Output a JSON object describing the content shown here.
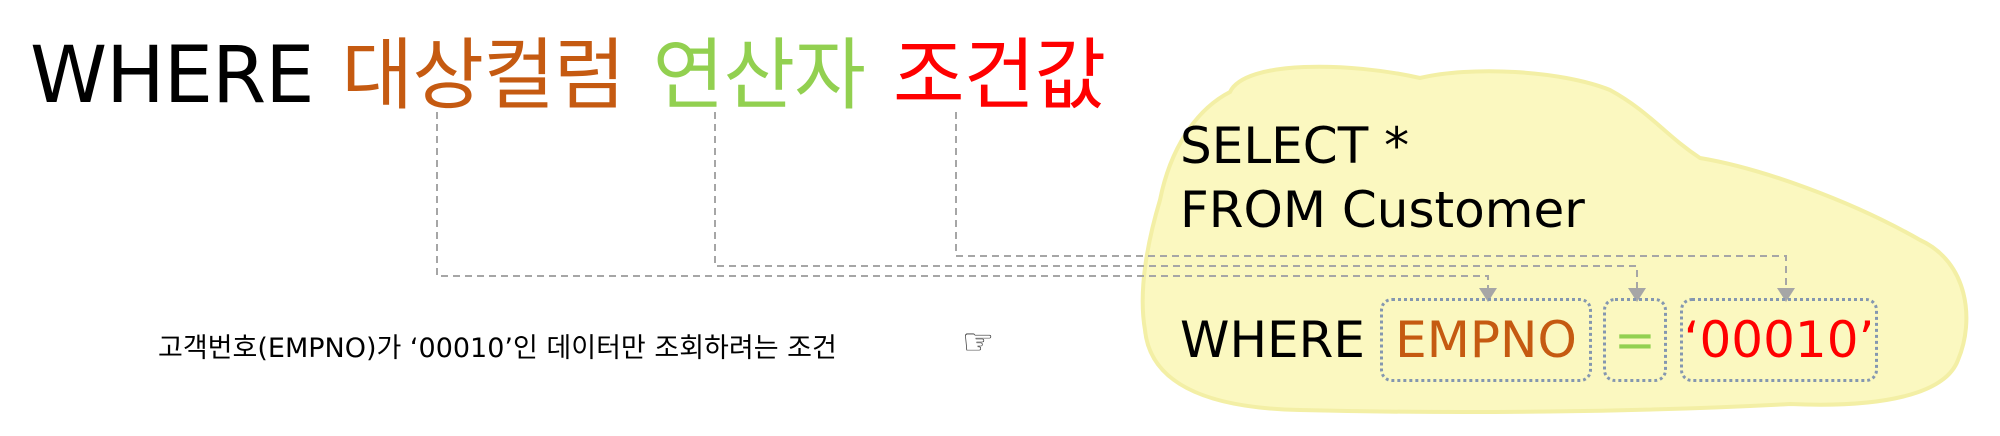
{
  "title": {
    "where": "WHERE",
    "column": "대상컬럼",
    "operator": "연산자",
    "value": "조건값"
  },
  "sql": {
    "select": "SELECT *",
    "from": "FROM Customer",
    "where": "WHERE",
    "column": "EMPNO",
    "operator": "=",
    "value": "‘00010’"
  },
  "caption": "고객번호(EMPNO)가 ‘00010’인 데이터만 조회하려는 조건",
  "hand_icon": "pointing-hand-icon",
  "colors": {
    "column": "#c55a11",
    "operator": "#92d050",
    "value": "#ff0000",
    "highlight": "#fbf8c0",
    "connector": "#a6a6a6",
    "box_border": "#8497b0"
  }
}
